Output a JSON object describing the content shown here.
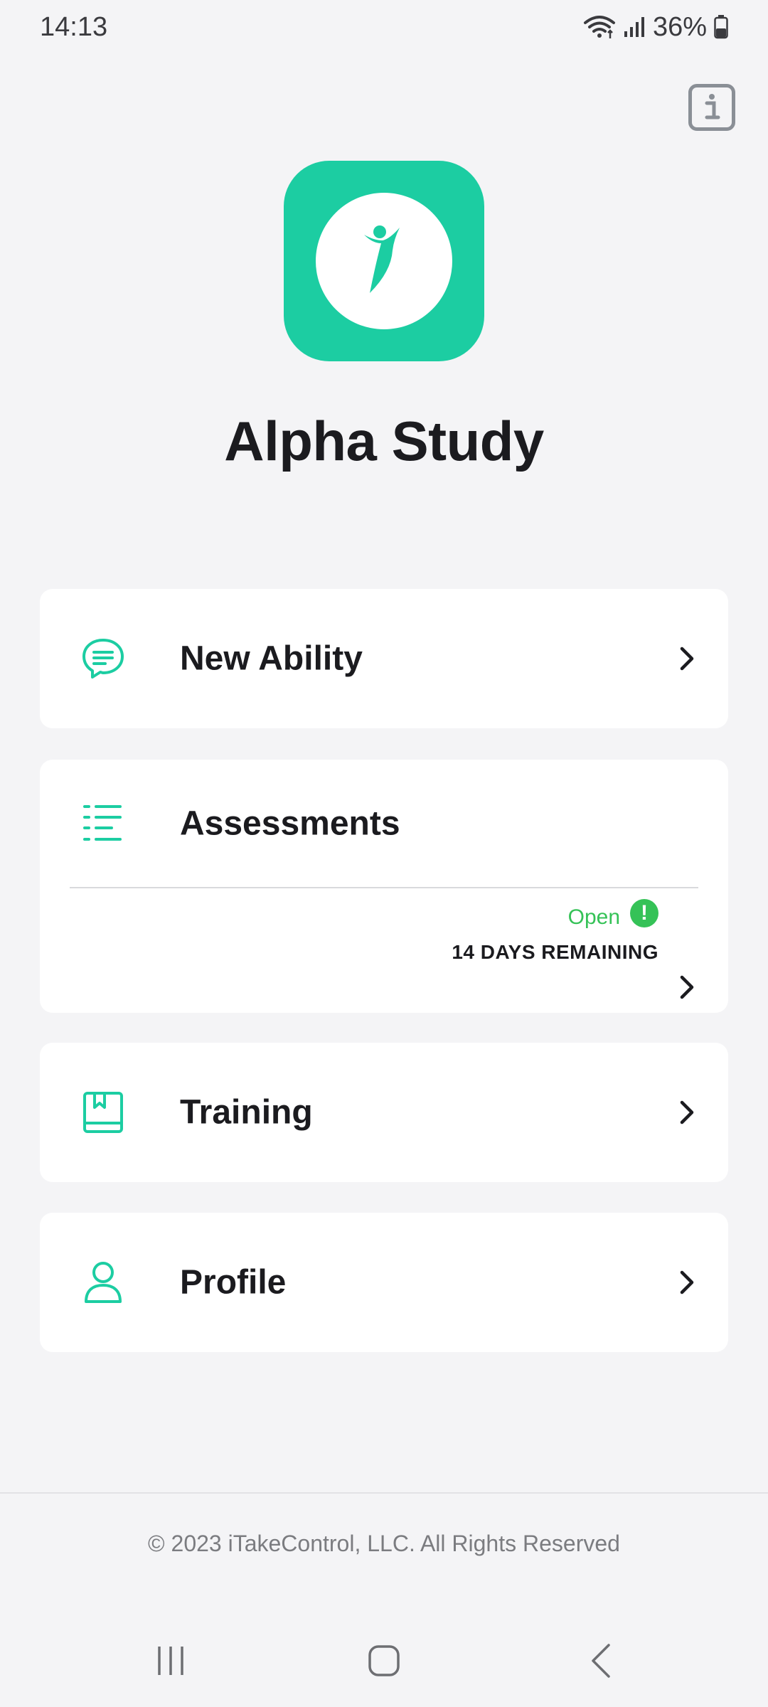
{
  "status_bar": {
    "time": "14:13",
    "battery": "36%",
    "icons": [
      "wifi-icon",
      "signal-icon",
      "battery-icon"
    ]
  },
  "header": {
    "info_icon": "info-icon"
  },
  "app": {
    "title": "Alpha Study",
    "logo_color": "#1ccda2"
  },
  "menu": {
    "new_ability": {
      "label": "New Ability",
      "icon": "chat-bubble-icon"
    },
    "assessments": {
      "label": "Assessments",
      "icon": "list-icon",
      "status": "Open",
      "status_badge": "!",
      "remaining": "14 DAYS REMAINING"
    },
    "training": {
      "label": "Training",
      "icon": "book-icon"
    },
    "profile": {
      "label": "Profile",
      "icon": "person-icon"
    }
  },
  "footer": {
    "copyright": "© 2023 iTakeControl, LLC. All Rights Reserved"
  },
  "colors": {
    "accent": "#1ccda2",
    "status_green": "#35c257",
    "background": "#f4f4f6"
  }
}
